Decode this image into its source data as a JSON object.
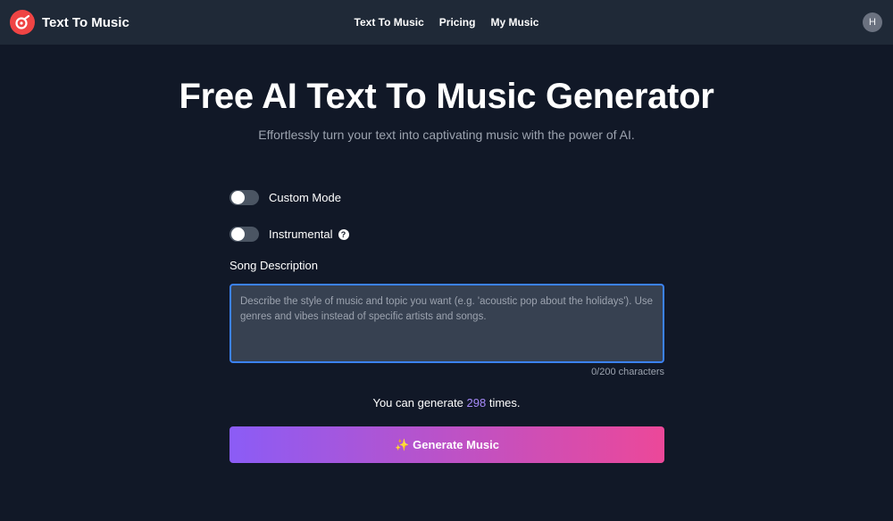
{
  "header": {
    "brand_name": "Text To Music",
    "nav": [
      "Text To Music",
      "Pricing",
      "My Music"
    ],
    "avatar_initial": "H"
  },
  "hero": {
    "title": "Free AI Text To Music Generator",
    "subtitle": "Effortlessly turn your text into captivating music with the power of AI."
  },
  "form": {
    "custom_mode_label": "Custom Mode",
    "custom_mode_on": false,
    "instrumental_label": "Instrumental",
    "instrumental_on": false,
    "help_glyph": "?",
    "description_label": "Song Description",
    "description_placeholder": "Describe the style of music and topic you want (e.g. 'acoustic pop about the holidays'). Use genres and vibes instead of specific artists and songs.",
    "description_value": "",
    "char_count": "0/200 characters",
    "quota_prefix": "You can generate ",
    "quota_count": "298",
    "quota_suffix": " times.",
    "generate_label": "Generate Music",
    "generate_icon": "✨"
  },
  "colors": {
    "page_bg": "#111827",
    "navbar_bg": "#1f2937",
    "logo_bg": "#ef4444",
    "accent_purple": "#8b5cf6",
    "accent_pink": "#ec4899",
    "focus_border": "#3b82f6",
    "quota_count": "#a78bfa"
  }
}
